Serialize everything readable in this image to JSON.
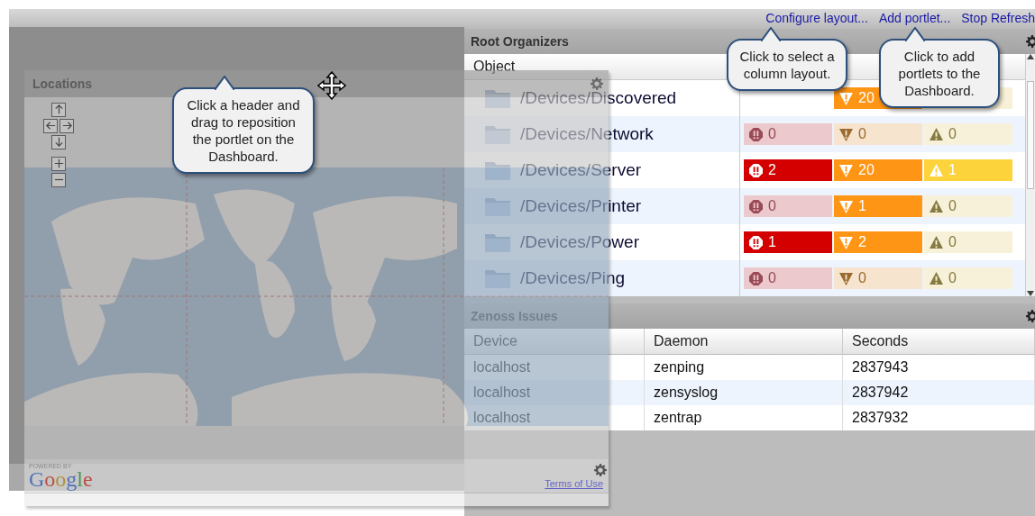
{
  "toolbar": {
    "links": [
      "Configure layout...",
      "Add portlet...",
      "Stop Refresh"
    ]
  },
  "root_organizers": {
    "title": "Root Organizers",
    "column": "Object",
    "rows": [
      {
        "name": "/Devices/Discovered",
        "severities": [
          {
            "kind": "critical"
          },
          {
            "kind": "error",
            "count": "20",
            "active": true
          },
          {
            "kind": "warning",
            "active": false
          }
        ]
      },
      {
        "name": "/Devices/Network",
        "severities": [
          {
            "kind": "critical",
            "count": "0",
            "active": false
          },
          {
            "kind": "error",
            "count": "0",
            "active": false
          },
          {
            "kind": "warning",
            "count": "0",
            "active": false
          }
        ]
      },
      {
        "name": "/Devices/Server",
        "severities": [
          {
            "kind": "critical",
            "count": "2",
            "active": true
          },
          {
            "kind": "error",
            "count": "20",
            "active": true
          },
          {
            "kind": "warning",
            "count": "1",
            "active": true
          }
        ]
      },
      {
        "name": "/Devices/Printer",
        "severities": [
          {
            "kind": "critical",
            "count": "0",
            "active": false
          },
          {
            "kind": "error",
            "count": "1",
            "active": true
          },
          {
            "kind": "warning",
            "count": "0",
            "active": false
          }
        ]
      },
      {
        "name": "/Devices/Power",
        "severities": [
          {
            "kind": "critical",
            "count": "1",
            "active": true
          },
          {
            "kind": "error",
            "count": "2",
            "active": true
          },
          {
            "kind": "warning",
            "count": "0",
            "active": false
          }
        ]
      },
      {
        "name": "/Devices/Ping",
        "severities": [
          {
            "kind": "critical",
            "count": "0",
            "active": false
          },
          {
            "kind": "error",
            "count": "0",
            "active": false
          },
          {
            "kind": "warning",
            "count": "0",
            "active": false
          }
        ]
      }
    ]
  },
  "zenoss_issues": {
    "title": "Zenoss Issues",
    "columns": [
      "Device",
      "Daemon",
      "Seconds"
    ],
    "rows": [
      [
        "localhost",
        "zenping",
        "2837943"
      ],
      [
        "localhost",
        "zensyslog",
        "2837942"
      ],
      [
        "localhost",
        "zentrap",
        "2837932"
      ]
    ]
  },
  "locations": {
    "title": "Locations",
    "powered_by": "POWERED BY",
    "logo": "Google",
    "terms_link": "Terms of Use"
  },
  "callouts": [
    {
      "text": "Click a header and drag to reposition the portlet on the Dashboard."
    },
    {
      "text": "Click to select a column layout."
    },
    {
      "text": "Click to add portlets to the Dashboard."
    }
  ]
}
